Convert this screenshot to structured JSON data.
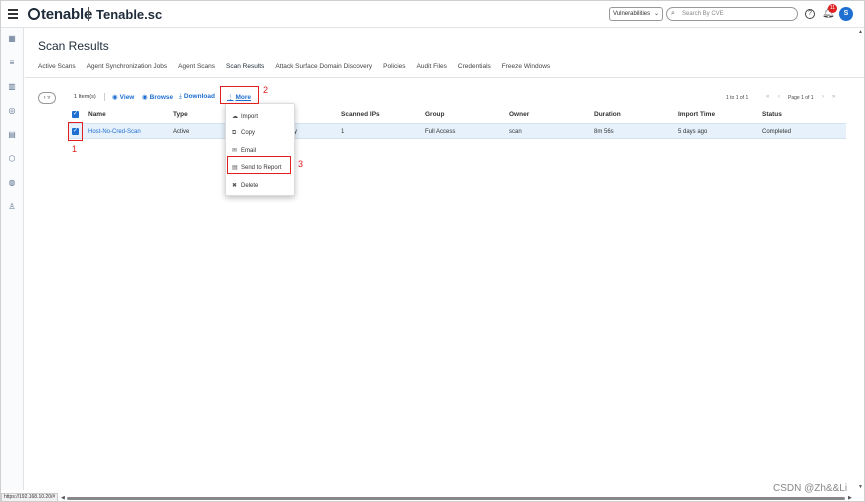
{
  "header": {
    "logo": "tenable",
    "product": "Tenable.sc",
    "context_select": "Vulnerabilities",
    "search_placeholder": "Search By CVE",
    "notification_count": "11",
    "avatar_initial": "S"
  },
  "page": {
    "title": "Scan Results",
    "tabs": [
      {
        "label": "Active Scans"
      },
      {
        "label": "Agent Synchronization Jobs"
      },
      {
        "label": "Agent Scans"
      },
      {
        "label": "Scan Results",
        "active": true
      },
      {
        "label": "Attack Surface Domain Discovery"
      },
      {
        "label": "Policies"
      },
      {
        "label": "Audit Files"
      },
      {
        "label": "Credentials"
      },
      {
        "label": "Freeze Windows"
      }
    ]
  },
  "toolbar": {
    "items_count": "1 Item(s)",
    "view": "View",
    "browse": "Browse",
    "download": "Download",
    "more": "More",
    "pager_range": "1 to 1 of 1",
    "pager_page": "Page 1 of 1"
  },
  "table": {
    "columns": [
      "Name",
      "Type",
      "Scanned IPs",
      "Group",
      "Owner",
      "Duration",
      "Import Time",
      "Status"
    ],
    "rows": [
      {
        "name": "Host-No-Cred-Scan",
        "type": "Active",
        "type_trail": "y",
        "scanned_ips": "1",
        "group": "Full Access",
        "owner": "scan",
        "duration": "8m 56s",
        "import_time": "5 days ago",
        "status": "Completed"
      }
    ]
  },
  "more_menu": {
    "items": [
      "Import",
      "Copy",
      "Email",
      "Send to Report",
      "Delete"
    ]
  },
  "annotations": [
    "1",
    "2",
    "3"
  ],
  "statusbar": {
    "url": "https://192.168.10.20/#"
  },
  "watermark": "CSDN @Zh&&Li",
  "colors": {
    "accent": "#1f6fd1",
    "annotation_red": "#e0201e",
    "selected_row": "#e6f1fb"
  }
}
